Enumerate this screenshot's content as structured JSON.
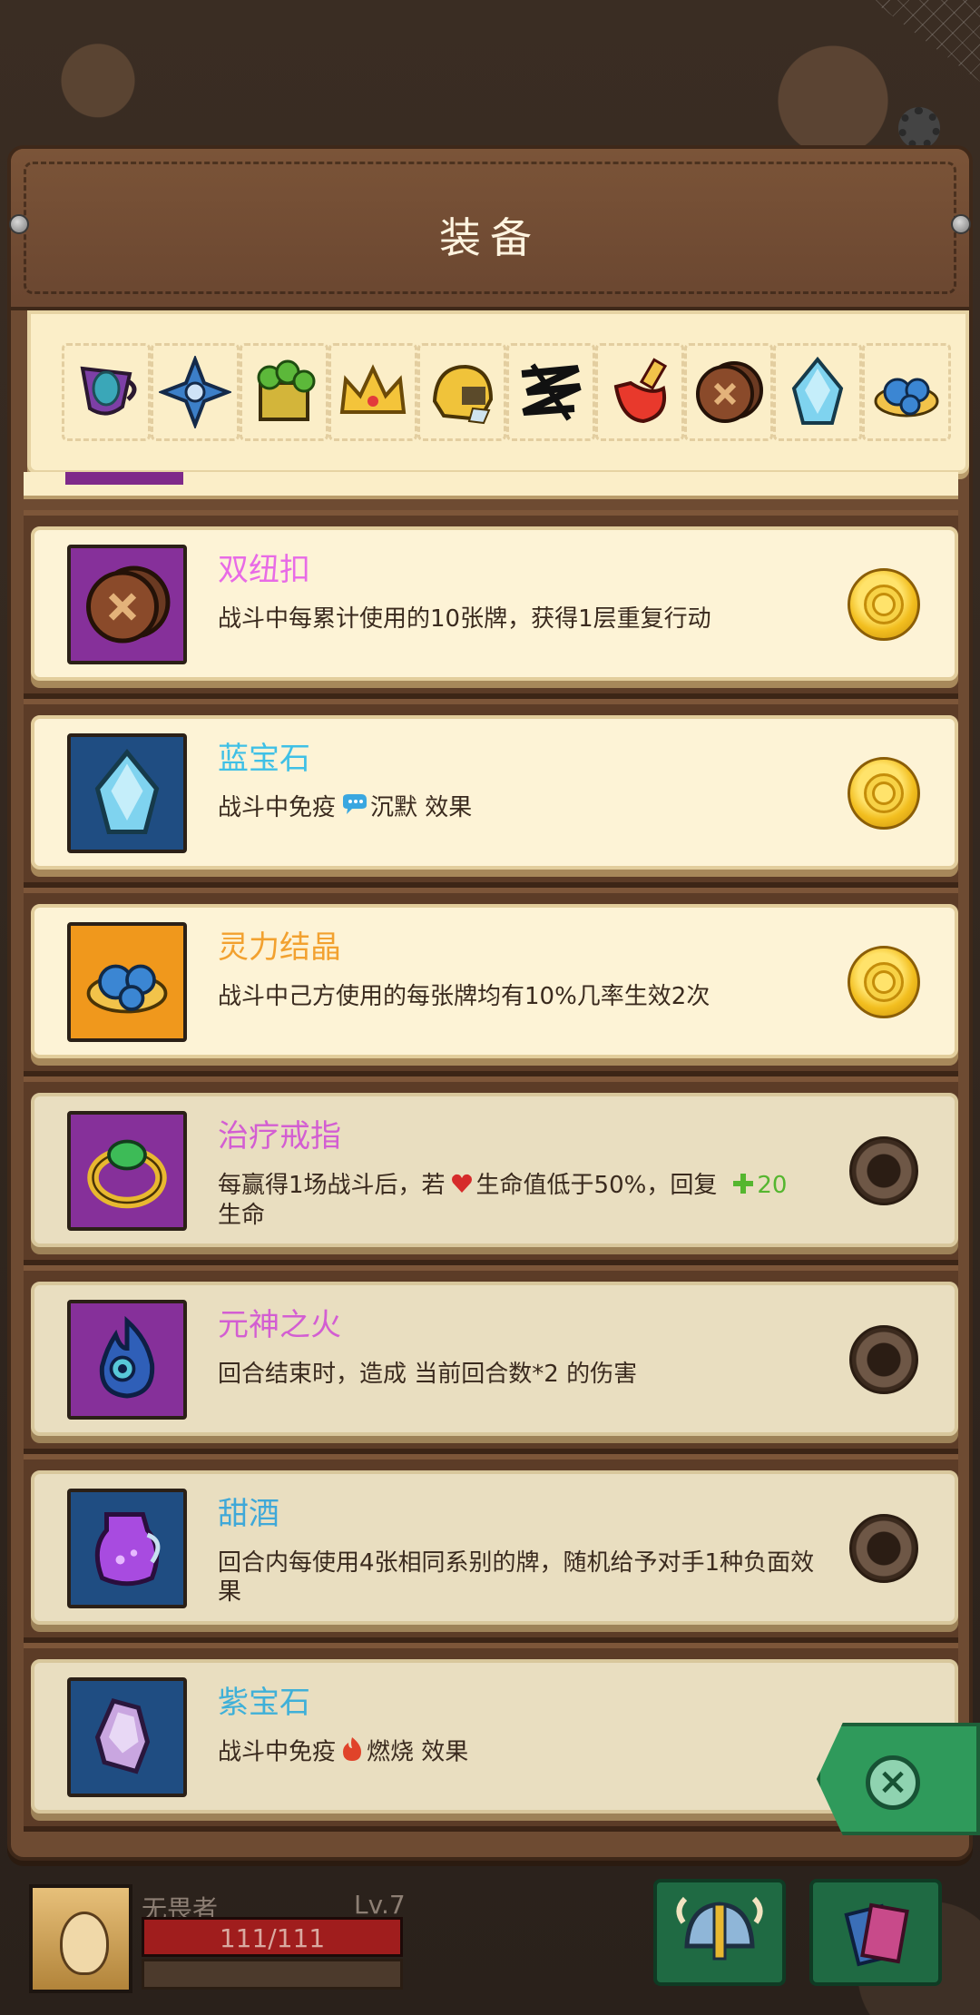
{
  "header": {
    "title": "装备"
  },
  "equipped": [
    {
      "name": "purple-goblet-icon"
    },
    {
      "name": "blue-shuriken-icon"
    },
    {
      "name": "clover-box-icon"
    },
    {
      "name": "gold-crown-icon"
    },
    {
      "name": "gold-helmet-icon"
    },
    {
      "name": "black-scribble-icon"
    },
    {
      "name": "red-potion-icon"
    },
    {
      "name": "twin-button-icon"
    },
    {
      "name": "sapphire-gem-icon"
    },
    {
      "name": "spirit-crystal-icon"
    }
  ],
  "items": [
    {
      "name": "双纽扣",
      "name_color": "#e86be6",
      "icon_bg": "purple",
      "icon": "twin-button-icon",
      "owned": true,
      "desc": "战斗中每累计使用的10张牌，获得1层重复行动"
    },
    {
      "name": "蓝宝石",
      "name_color": "#3fc0e6",
      "icon_bg": "blue",
      "icon": "sapphire-gem-icon",
      "owned": true,
      "desc_pre": "战斗中免疫",
      "desc_kw": "沉默",
      "desc_post": "效果"
    },
    {
      "name": "灵力结晶",
      "name_color": "#f2a12f",
      "icon_bg": "orange",
      "icon": "spirit-crystal-icon",
      "owned": true,
      "desc": "战斗中己方使用的每张牌均有10%几率生效2次"
    },
    {
      "name": "治疗戒指",
      "name_color": "#d35ed2",
      "icon_bg": "purple",
      "icon": "heal-ring-icon",
      "owned": false,
      "desc_pre": "每赢得1场战斗后，若",
      "desc_kw": "生命值低于50%，回复",
      "desc_num": "20",
      "desc_post": "生命"
    },
    {
      "name": "元神之火",
      "name_color": "#d35ed2",
      "icon_bg": "purple",
      "icon": "spirit-fire-icon",
      "owned": false,
      "desc": "回合结束时，造成 当前回合数*2 的伤害"
    },
    {
      "name": "甜酒",
      "name_color": "#3fa8d8",
      "icon_bg": "blue",
      "icon": "sweet-wine-icon",
      "owned": false,
      "desc": "回合内每使用4张相同系别的牌，随机给予对手1种负面效果"
    },
    {
      "name": "紫宝石",
      "name_color": "#3fb0d8",
      "icon_bg": "blue",
      "icon": "amethyst-icon",
      "owned": false,
      "desc_pre": "战斗中免疫",
      "desc_kw": "燃烧",
      "desc_post": "效果"
    }
  ],
  "player": {
    "name": "无畏者",
    "level": "Lv.7",
    "hp_text": "111/111",
    "hp_fraction": 1.0
  },
  "colors": {
    "accent_green": "#2f9a5b",
    "hp_red": "#a01d1d",
    "coin_gold": "#f2be1f"
  }
}
